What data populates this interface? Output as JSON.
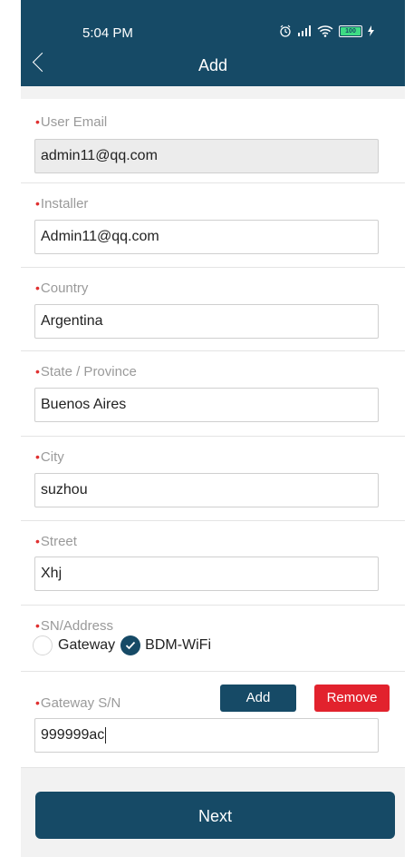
{
  "status_bar": {
    "time": "5:04 PM",
    "battery": "100",
    "icons": [
      "alarm-icon",
      "signal-icon",
      "wifi-icon",
      "battery-icon",
      "charging-icon"
    ]
  },
  "header": {
    "title": "Add",
    "back_icon": "chevron-left-icon"
  },
  "form": {
    "required_mark": "•",
    "user_email": {
      "label": "User Email",
      "value": "admin11@qq.com",
      "disabled": true
    },
    "installer": {
      "label": "Installer",
      "value": "Admin11@qq.com"
    },
    "country": {
      "label": "Country",
      "value": "Argentina"
    },
    "state": {
      "label": "State / Province",
      "value": "Buenos Aires"
    },
    "city": {
      "label": "City",
      "value": "suzhou"
    },
    "street": {
      "label": "Street",
      "value": "Xhj"
    },
    "sn_address": {
      "label": "SN/Address",
      "options": [
        {
          "label": "Gateway",
          "selected": false
        },
        {
          "label": "BDM-WiFi",
          "selected": true
        }
      ]
    },
    "gateway_sn": {
      "label": "Gateway S/N",
      "value": "999999ac",
      "add_label": "Add",
      "remove_label": "Remove"
    }
  },
  "footer": {
    "next_label": "Next"
  },
  "colors": {
    "primary": "#164a66",
    "danger": "#e2222d",
    "required": "#e03030"
  }
}
